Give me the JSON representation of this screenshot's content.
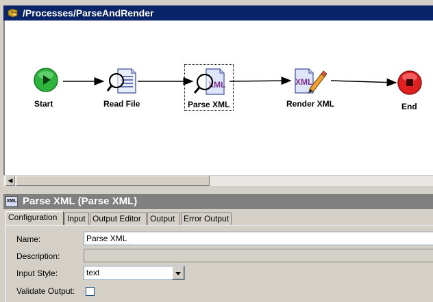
{
  "process": {
    "title": "/Processes/ParseAndRender",
    "nodes": [
      {
        "label": "Start",
        "icon": "start-play-icon"
      },
      {
        "label": "Read File",
        "icon": "read-file-icon"
      },
      {
        "label": "Parse XML",
        "icon": "parse-xml-icon"
      },
      {
        "label": "Render XML",
        "icon": "render-xml-icon"
      },
      {
        "label": "End",
        "icon": "end-stop-icon"
      }
    ]
  },
  "properties": {
    "title": "Parse XML (Parse XML)",
    "icon_text": "XML",
    "tabs": [
      "Configuration",
      "Input",
      "Output Editor",
      "Output",
      "Error Output"
    ],
    "active_tab": "Configuration",
    "fields": {
      "name": {
        "label": "Name:",
        "value": "Parse XML"
      },
      "description": {
        "label": "Description:",
        "value": ""
      },
      "input_style": {
        "label": "Input Style:",
        "value": "text"
      },
      "validate_output": {
        "label": "Validate Output:",
        "checked": false
      }
    }
  },
  "colors": {
    "title_active": "#0a246a",
    "title_inactive": "#808080",
    "start_green": "#2db43c",
    "end_red": "#e02020"
  }
}
